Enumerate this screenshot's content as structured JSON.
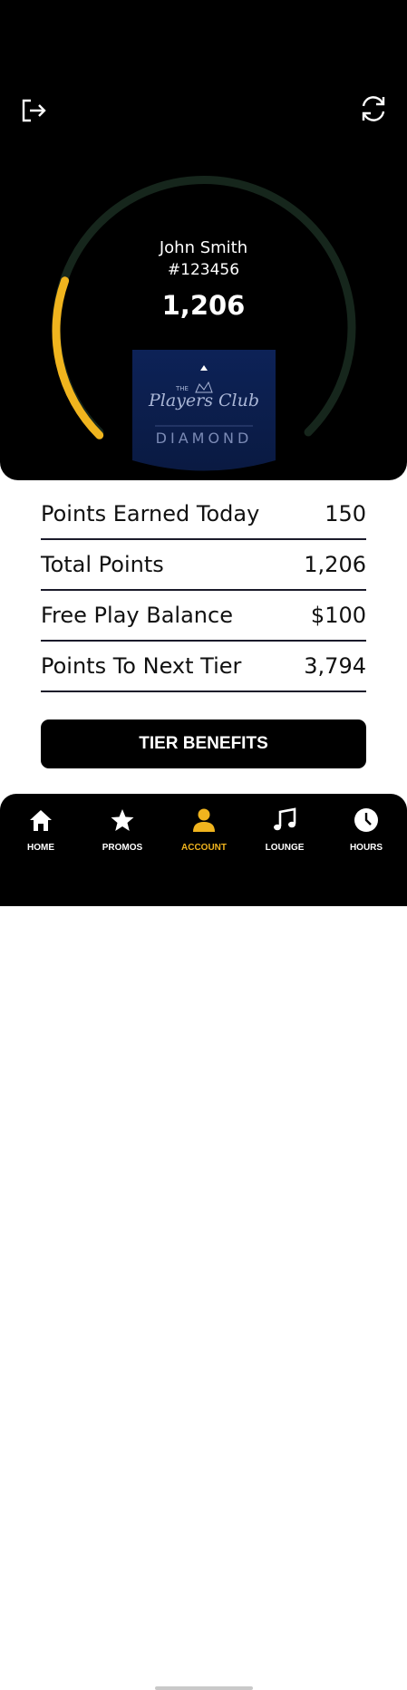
{
  "member": {
    "name": "John Smith",
    "id": "#123456",
    "points": "1,206",
    "progress_fraction": 0.24
  },
  "tier": {
    "logo_small": "THE",
    "logo_text": "Players Club",
    "name": "DIAMOND"
  },
  "stats": [
    {
      "label": "Points Earned Today",
      "value": "150"
    },
    {
      "label": "Total Points",
      "value": "1,206"
    },
    {
      "label": "Free Play Balance",
      "value": "$100"
    },
    {
      "label": "Points To Next Tier",
      "value": "3,794"
    }
  ],
  "tier_benefits_label": "TIER BENEFITS",
  "nav": [
    {
      "label": "HOME",
      "icon": "home-icon"
    },
    {
      "label": "PROMOS",
      "icon": "star-icon"
    },
    {
      "label": "ACCOUNT",
      "icon": "account-icon",
      "active": true
    },
    {
      "label": "LOUNGE",
      "icon": "music-note-icon"
    },
    {
      "label": "HOURS",
      "icon": "clock-icon"
    }
  ],
  "colors": {
    "accent": "#f0b41e",
    "gauge_track": "#16261c",
    "tier_card": "#0d2257"
  }
}
